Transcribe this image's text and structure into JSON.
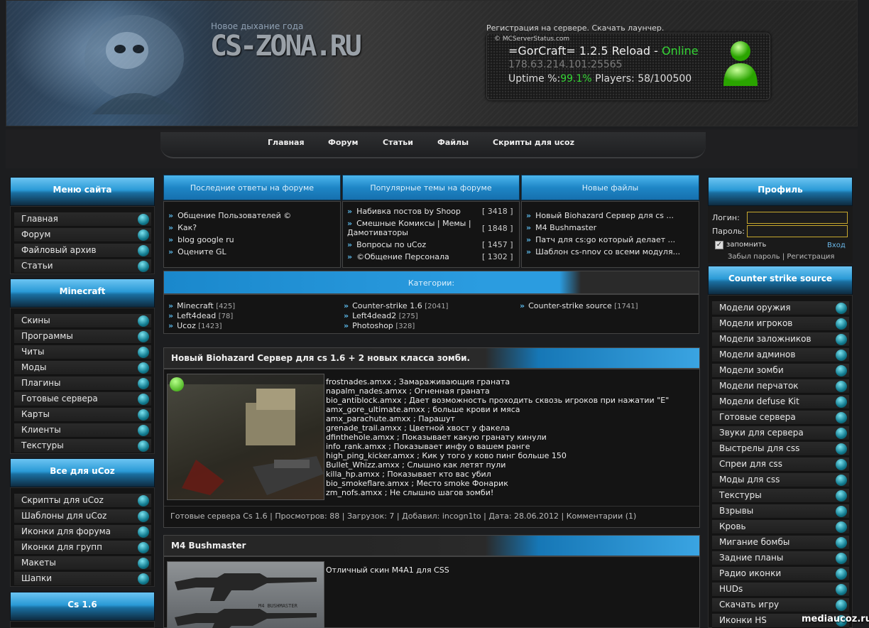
{
  "header": {
    "slogan": "Новое дыхание года",
    "logo": "CS-ZONA.RU",
    "reg_link": "Регистрация на сервере. Скачать лаунчер."
  },
  "server": {
    "source": "© MCServerStatus.com",
    "name": "=GorCraft= 1.2.5 Reload - ",
    "status": "Online",
    "ip": "178.63.214.101:25565",
    "uptime_label": "Uptime %:",
    "uptime": "99.1%",
    "players": "Players: 58/100500"
  },
  "nav": [
    "Главная",
    "Форум",
    "Статьи",
    "Файлы",
    "Скрипты для ucoz"
  ],
  "site_menu": {
    "title": "Меню сайта",
    "items": [
      "Главная",
      "Форум",
      "Файловый архив",
      "Статьи"
    ]
  },
  "minecraft": {
    "title": "Minecraft",
    "items": [
      "Скины",
      "Программы",
      "Читы",
      "Моды",
      "Плагины",
      "Готовые сервера",
      "Карты",
      "Клиенты",
      "Текстуры"
    ]
  },
  "ucoz": {
    "title": "Все для uCoz",
    "items": [
      "Скрипты для uCoz",
      "Шаблоны для uCoz",
      "Иконки для форума",
      "Иконки для групп",
      "Макеты",
      "Шапки"
    ]
  },
  "cs16": {
    "title": "Cs 1.6"
  },
  "forum_recent": {
    "title": "Последние ответы на форуме",
    "items": [
      "Общение Пользователей ©",
      "Как?",
      "blog google ru",
      "Оцените GL"
    ]
  },
  "forum_popular": {
    "title": "Популярные темы на форуме",
    "items": [
      {
        "line1": "Набивка постов by Shoop",
        "count": "[ 3418 ]"
      },
      {
        "line1": "Смешные Комиксы | Мемы |",
        "line2": "Дамотиваторы",
        "count": "[ 1848 ]"
      },
      {
        "line1": "Вопросы по uCoz",
        "count": "[ 1457 ]"
      },
      {
        "line1": "©Общение Персонала",
        "count": "[ 1302 ]"
      }
    ]
  },
  "new_files": {
    "title": "Новые файлы",
    "items": [
      "Новый Biohazard Сервер для cs ...",
      "M4 Bushmaster",
      "Патч для cs:go который делает ...",
      "Шаблон cs-nnov со всеми модуля..."
    ]
  },
  "categories": {
    "title": "Категории:",
    "items": [
      {
        "name": "Minecraft",
        "count": "[425]"
      },
      {
        "name": "Counter-strike 1.6",
        "count": "[2041]"
      },
      {
        "name": "Counter-strike source",
        "count": "[1741]"
      },
      {
        "name": "Left4dead",
        "count": "[78]"
      },
      {
        "name": "Left4dead2",
        "count": "[275]"
      },
      {
        "name": "Ucoz",
        "count": "[1423]"
      },
      {
        "name": "Photoshop",
        "count": "[328]"
      }
    ]
  },
  "post1": {
    "title": "Новый Biohazard Сервер для cs 1.6 + 2 новых класса зомби.",
    "lines": [
      "frostnades.amxx ; Замараживающия граната",
      "napalm_nades.amxx ; Огненная граната",
      "bio_antiblock.amxx ; Дает возможность проходить сквозь игроков при нажатии \"E\"",
      "amx_gore_ultimate.amxx ; больше крови и мяса",
      "amx_parachute.amxx ; Парашут",
      "grenade_trail.amxx ; Цветной хвост у факела",
      "dfinthehole.amxx ; Показывает какую гранату кинули",
      "info_rank.amxx ; Показывает инфу о вашем ранге",
      "high_ping_kicker.amxx ; Кик у того у ково пинг больше 150",
      "Bullet_Whizz.amxx ; Слышно как летят пули",
      "killa_hp.amxx ; Показывает кто вас убил",
      "bio_smokeflare.amxx ; Место smoke Фонарик",
      "zm_nofs.amxx ; Не слышно шагов зомби!"
    ],
    "footer": "Готовые сервера Cs 1.6 | Просмотров: 88 | Загрузок: 7 | Добавил: incogn1to | Дата: 28.06.2012 | Комментарии (1)"
  },
  "post2": {
    "title": "M4 Bushmaster",
    "text": "Отличный скин M4A1 для CSS",
    "image_caption": "M4 BUSHMASTER"
  },
  "profile": {
    "title": "Профиль",
    "login_label": "Логин:",
    "password_label": "Пароль:",
    "remember": "запомнить",
    "login_button": "Вход",
    "forgot": "Забыл пароль",
    "register": "Регистрация"
  },
  "css": {
    "title": "Counter strike source",
    "items": [
      "Модели оружия",
      "Модели игроков",
      "Модели заложников",
      "Модели админов",
      "Модели зомби",
      "Модели перчаток",
      "Модели defuse Kit",
      "Готовые сервера",
      "Звуки для сервера",
      "Выстрелы для css",
      "Спреи для css",
      "Моды для css",
      "Текстуры",
      "Взрывы",
      "Кровь",
      "Мигание бомбы",
      "Задние планы",
      "Радио иконки",
      "HUDs",
      "Скачать игру",
      "Иконки HS"
    ]
  },
  "watermark": "mediaucoz.ru"
}
